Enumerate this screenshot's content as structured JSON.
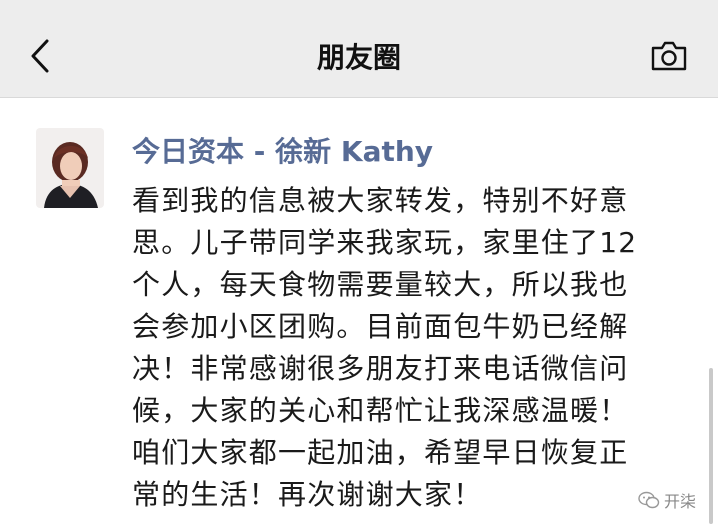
{
  "header": {
    "title": "朋友圈",
    "back_icon": "chevron-left-icon",
    "camera_icon": "camera-icon"
  },
  "post": {
    "author": "今日资本 - 徐新 Kathy",
    "content_lines": [
      "看到我的信息被大家转发，特别不好意",
      "思。儿子带同学来我家玩，家里住了12",
      "个人，每天食物需要量较大，所以我也",
      "会参加小区团购。目前面包牛奶已经解",
      "决！非常感谢很多朋友打来电话微信问",
      "候，大家的关心和帮忙让我深感温暖！",
      "咱们大家都一起加油，希望早日恢复正",
      "常的生活！再次谢谢大家！"
    ]
  },
  "watermark": {
    "text": "开柒",
    "icon": "wechat-icon"
  },
  "colors": {
    "header_bg": "#ededed",
    "author_link": "#576b95",
    "text": "#1a1a1a"
  }
}
